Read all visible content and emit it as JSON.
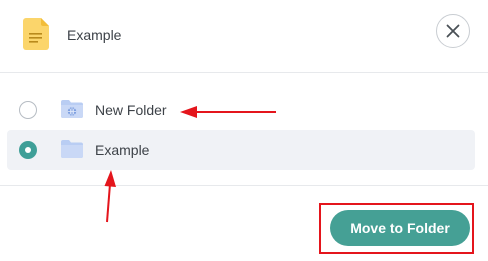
{
  "header": {
    "title": "Example",
    "file_icon": "document-icon",
    "close_icon": "close-icon"
  },
  "folders": [
    {
      "label": "New Folder",
      "icon": "shared-folder-icon",
      "selected": false
    },
    {
      "label": "Example",
      "icon": "folder-icon",
      "selected": true
    }
  ],
  "footer": {
    "move_button_label": "Move to Folder"
  },
  "colors": {
    "accent": "#45a095",
    "radio_checked": "#3f9f98",
    "annotation": "#e4151c",
    "selected_row_bg": "#f0f2f6",
    "folder_fill": "#b9cdf3"
  }
}
